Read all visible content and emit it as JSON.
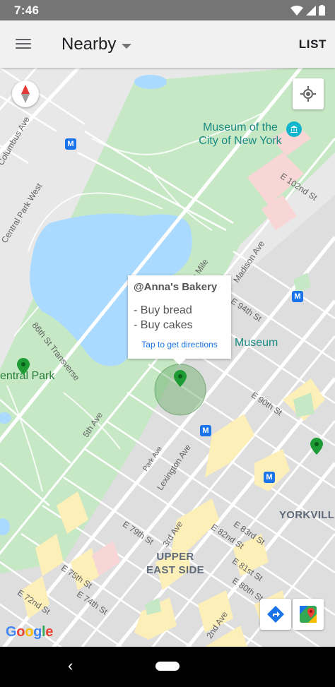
{
  "status_bar": {
    "time": "7:46"
  },
  "app_bar": {
    "title": "Nearby",
    "list_button": "LIST"
  },
  "info_window": {
    "title": "@Anna's Bakery",
    "lines": [
      "- Buy bread",
      "- Buy cakes"
    ],
    "link": "Tap to get directions"
  },
  "map": {
    "pois": {
      "museum_city_ny": "Museum of the\nCity of New York",
      "museum_partial": "Museum",
      "central_park": "entral Park"
    },
    "districts": {
      "yorkville": "YORKVILLE",
      "upper_east_side": "UPPER\nEAST SIDE"
    },
    "streets": {
      "columbus_ave": "Columbus Ave",
      "central_park_west": "Central Park West",
      "transverse_86": "86th St Transverse",
      "fifth_ave": "5th Ave",
      "park_ave": "Park Ave",
      "lexington_ave": "Lexington Ave",
      "third_ave": "3rd Ave",
      "second_ave": "2nd Ave",
      "e_102nd": "E 102nd St",
      "e_94th": "E 94th St",
      "e_90th": "E 90th St",
      "e_82nd": "E 82nd St",
      "e_83rd": "E 83rd St",
      "e_81st": "E 81st St",
      "e_80th": "E 80th St",
      "e_79th": "E 79th St",
      "e_75th": "E 75th St",
      "e_74th": "E 74th St",
      "e_72nd": "E 72nd St",
      "madison_ave": "Madison Ave",
      "museum_mile": "um Mile"
    },
    "metro_glyph": "M",
    "google_logo": [
      "G",
      "o",
      "o",
      "g",
      "l",
      "e"
    ],
    "google_colors": [
      "#4285F4",
      "#EA4335",
      "#FBBC05",
      "#4285F4",
      "#34A853",
      "#EA4335"
    ]
  },
  "icons": {
    "wifi": "wifi-icon",
    "signal": "signal-icon",
    "battery": "battery-icon",
    "compass": "compass-icon",
    "my_location": "my-location-icon",
    "directions": "directions-icon",
    "google_maps": "google-maps-icon"
  },
  "colors": {
    "park_green": "#c6e8c5",
    "water_blue": "#aadaff",
    "pin_green": "#1e9b35",
    "link_blue": "#1a73e8"
  },
  "nav_bar": {
    "back_glyph": "‹"
  }
}
